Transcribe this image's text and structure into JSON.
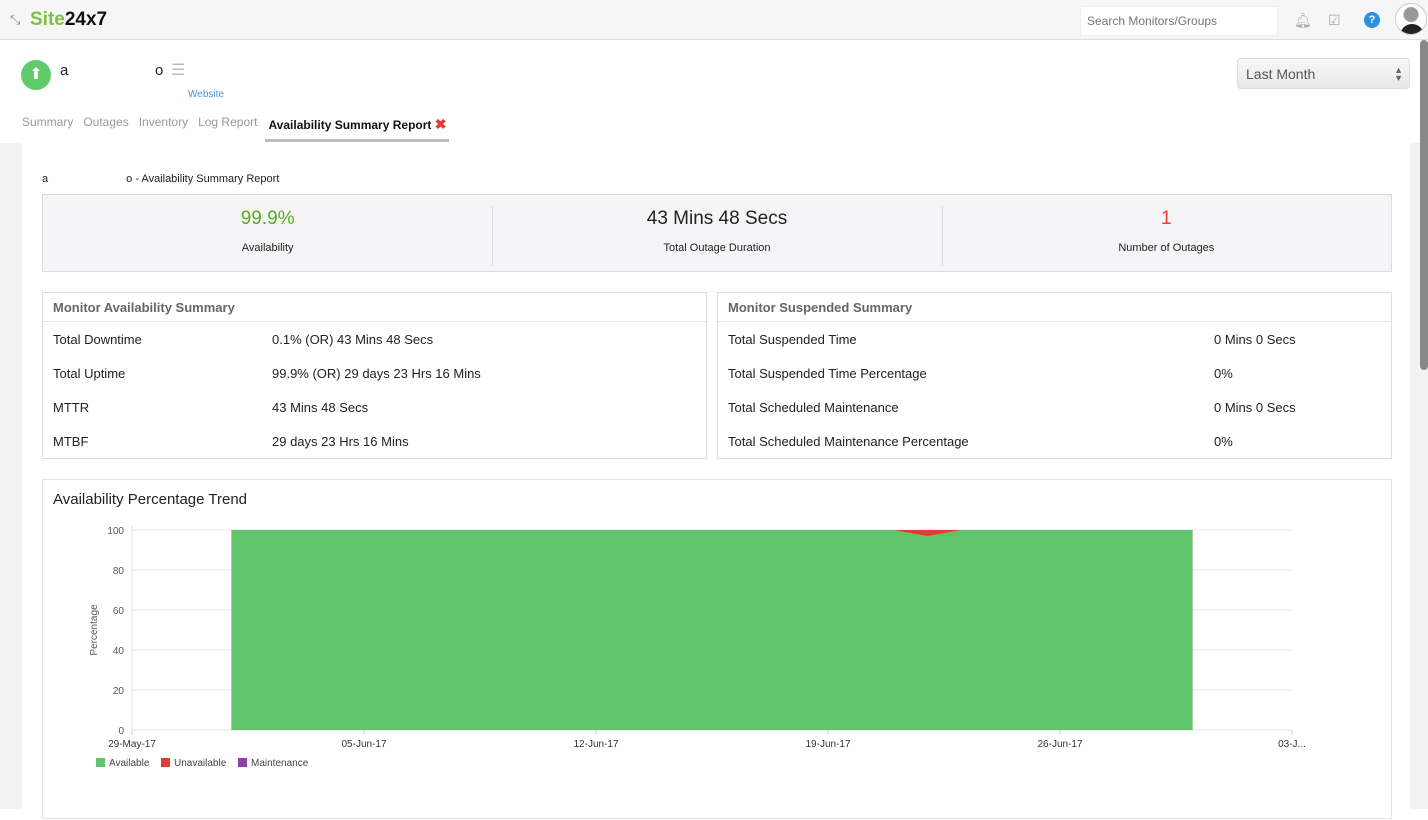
{
  "topbar": {
    "logo_green": "Site",
    "logo_dark": "24x7",
    "search_placeholder": "Search Monitors/Groups",
    "help": "?"
  },
  "monitor": {
    "name_start": "a",
    "name_end": "o",
    "type": "Website",
    "status": "up"
  },
  "period": "Last Month",
  "tabs": [
    {
      "label": "Summary"
    },
    {
      "label": "Outages"
    },
    {
      "label": "Inventory"
    },
    {
      "label": "Log Report"
    },
    {
      "label": "Availability Summary Report",
      "active": true
    }
  ],
  "report": {
    "title_start": "a",
    "title_end": "o",
    "title_suffix": "- Availability Summary Report"
  },
  "stats": [
    {
      "value": "99.9%",
      "label": "Availability",
      "color": "#5aac1f"
    },
    {
      "value": "43 Mins 48 Secs",
      "label": "Total Outage Duration",
      "color": "#111111"
    },
    {
      "value": "1",
      "label": "Number of Outages",
      "color": "#e23d2d"
    }
  ],
  "availability_summary": {
    "title": "Monitor Availability Summary",
    "rows": [
      {
        "k": "Total Downtime",
        "v": "0.1% (OR) 43 Mins 48 Secs"
      },
      {
        "k": "Total Uptime",
        "v": "99.9% (OR) 29 days 23 Hrs 16 Mins"
      },
      {
        "k": "MTTR",
        "v": "43 Mins 48 Secs"
      },
      {
        "k": "MTBF",
        "v": "29 days 23 Hrs 16 Mins"
      }
    ]
  },
  "suspended_summary": {
    "title": "Monitor Suspended Summary",
    "rows": [
      {
        "k": "Total Suspended Time",
        "v": "0 Mins 0 Secs"
      },
      {
        "k": "Total Suspended Time Percentage",
        "v": "0%"
      },
      {
        "k": "Total Scheduled Maintenance",
        "v": "0 Mins 0 Secs"
      },
      {
        "k": "Total Scheduled Maintenance Percentage",
        "v": "0%"
      }
    ]
  },
  "chart_data": {
    "type": "area",
    "title": "Availability Percentage Trend",
    "ylabel": "Percentage",
    "xlabel": "",
    "ylim": [
      0,
      100
    ],
    "yticks": [
      "0",
      "20",
      "40",
      "60",
      "80",
      "100"
    ],
    "xticks": [
      "29-May-17",
      "05-Jun-17",
      "12-Jun-17",
      "19-Jun-17",
      "26-Jun-17",
      "03-J..."
    ],
    "x_start_day": 0,
    "x_end_day": 35,
    "series": [
      {
        "name": "Available",
        "color": "#5fc46b",
        "start_day": 3,
        "end_day": 32,
        "values": [
          100,
          100,
          100,
          100,
          100,
          100,
          100,
          100,
          100,
          100,
          100,
          100,
          100,
          100,
          100,
          100,
          100,
          100,
          100,
          100,
          100,
          97,
          100,
          100,
          100,
          100,
          100,
          100,
          100,
          100
        ]
      },
      {
        "name": "Unavailable",
        "color": "#e03c31",
        "dip_day": 24,
        "dip_value": 3
      },
      {
        "name": "Maintenance",
        "color": "#8e3fad"
      }
    ]
  }
}
